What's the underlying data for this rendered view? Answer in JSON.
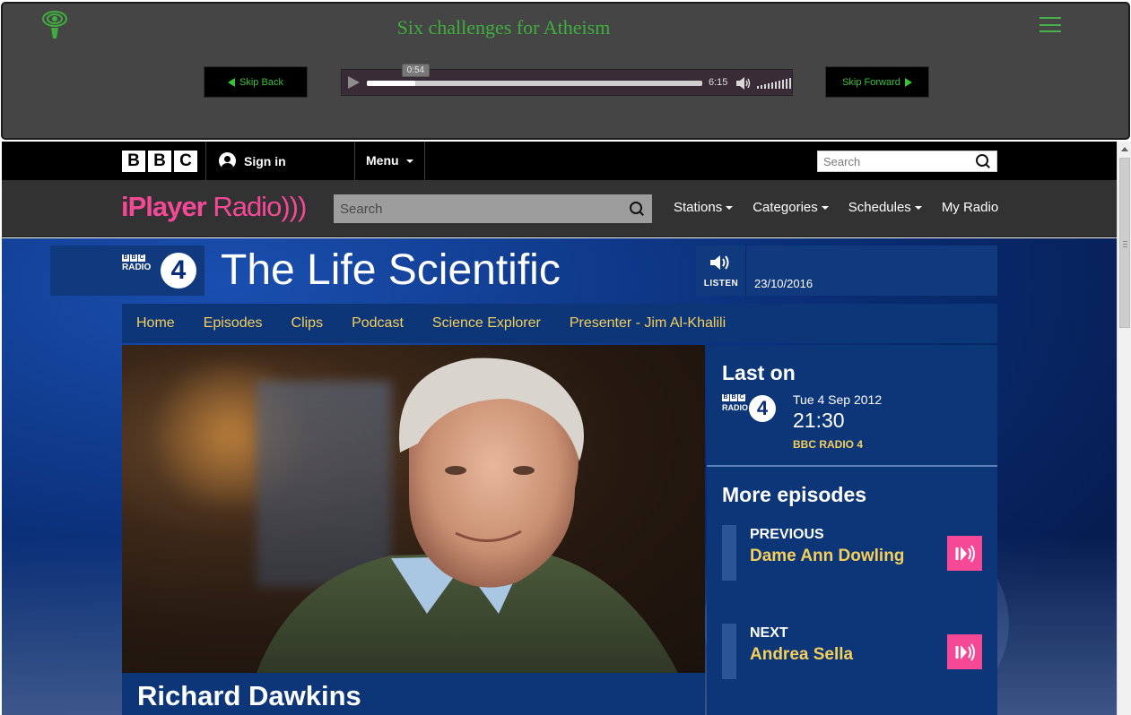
{
  "player": {
    "title": "Six challenges for Atheism",
    "skip_back_label": "Skip Back",
    "skip_forward_label": "Skip Forward",
    "current_time": "0:54",
    "duration": "6:15",
    "progress_fraction": 0.144
  },
  "bbc_bar": {
    "logo_letters": [
      "B",
      "B",
      "C"
    ],
    "sign_in_label": "Sign in",
    "menu_label": "Menu",
    "search_placeholder": "Search"
  },
  "iplayer_bar": {
    "logo_bold": "iPlayer",
    "logo_light": " Radio",
    "search_placeholder": "Search",
    "nav": [
      {
        "label": "Stations"
      },
      {
        "label": "Categories"
      },
      {
        "label": "Schedules"
      },
      {
        "label": "My Radio"
      }
    ]
  },
  "programme": {
    "station_logo": {
      "bbc": [
        "B",
        "B",
        "C"
      ],
      "radio": "RADIO",
      "number": "4"
    },
    "title": "The Life Scientific",
    "listen_label": "LISTEN",
    "date": "23/10/2016",
    "nav": [
      "Home",
      "Episodes",
      "Clips",
      "Podcast",
      "Science Explorer",
      "Presenter - Jim Al-Khalili"
    ],
    "episode_name": "Richard Dawkins"
  },
  "side": {
    "last_on_heading": "Last on",
    "last_on_date": "Tue 4 Sep 2012",
    "last_on_time": "21:30",
    "last_on_station": "BBC RADIO 4",
    "more_heading": "More episodes",
    "previous_kind": "PREVIOUS",
    "previous_title": "Dame Ann Dowling",
    "next_kind": "NEXT",
    "next_title": "Andrea Sella"
  },
  "colors": {
    "player_green": "#3fae3f",
    "iplayer_pink": "#f54997",
    "link_yellow": "#f4cf5b",
    "panel_blue": "#0c3678"
  }
}
